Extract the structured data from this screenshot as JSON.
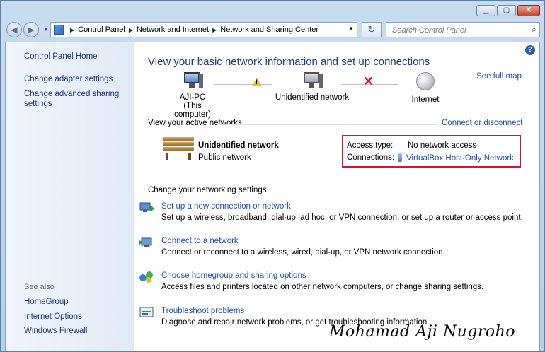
{
  "window": {
    "buttons": {
      "minimize": "▁",
      "maximize": "▢",
      "close": "✕"
    }
  },
  "navbar": {
    "breadcrumbs": [
      "Control Panel",
      "Network and Internet",
      "Network and Sharing Center"
    ],
    "search_placeholder": "Search Control Panel"
  },
  "sidebar": {
    "home": "Control Panel Home",
    "items": [
      "Change adapter settings",
      "Change advanced sharing settings"
    ],
    "see_also_label": "See also",
    "see_also": [
      "HomeGroup",
      "Internet Options",
      "Windows Firewall"
    ]
  },
  "main": {
    "title": "View your basic network information and set up connections",
    "see_full_map": "See full map",
    "map": {
      "computer_name": "AJI-PC",
      "computer_sub": "(This computer)",
      "network_name": "Unidentified network",
      "internet": "Internet",
      "status_icons": [
        "warning-icon",
        "red-x-icon"
      ]
    },
    "active_networks_label": "View your active networks",
    "connect_disconnect": "Connect or disconnect",
    "active_network": {
      "name": "Unidentified network",
      "type": "Public network",
      "access_type_label": "Access type:",
      "access_type_value": "No network access",
      "connections_label": "Connections:",
      "connections_value": "VirtualBox Host-Only Network"
    },
    "change_settings_label": "Change your networking settings",
    "tasks": [
      {
        "link": "Set up a new connection or network",
        "desc": "Set up a wireless, broadband, dial-up, ad hoc, or VPN connection; or set up a router or access point."
      },
      {
        "link": "Connect to a network",
        "desc": "Connect or reconnect to a wireless, wired, dial-up, or VPN network connection."
      },
      {
        "link": "Choose homegroup and sharing options",
        "desc": "Access files and printers located on other network computers, or change sharing settings."
      },
      {
        "link": "Troubleshoot problems",
        "desc": "Diagnose and repair network problems, or get troubleshooting information."
      }
    ]
  },
  "watermark": "Mohamad Aji Nugroho"
}
